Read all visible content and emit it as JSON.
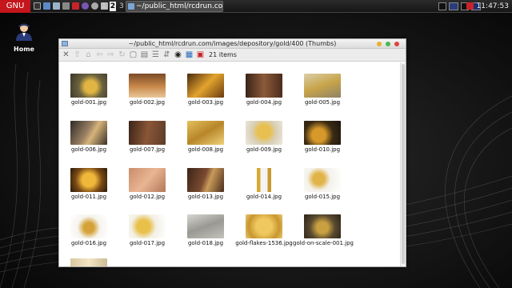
{
  "panel": {
    "menu_label": "GNU",
    "workspaces": [
      "1",
      "2",
      "3",
      "4"
    ],
    "active_workspace": "2",
    "task_title": "~/public_html/rcdrun.com/ima...",
    "clock": "11:47:53"
  },
  "desktop": {
    "home_label": "Home"
  },
  "window": {
    "title": "~/public_html/rcdrun.com/images/depository/gold/400 (Thumbs)",
    "items_count": "21 items",
    "files": [
      {
        "name": "gold-001.jpg"
      },
      {
        "name": "gold-002.jpg"
      },
      {
        "name": "gold-003.jpg"
      },
      {
        "name": "gold-004.jpg"
      },
      {
        "name": "gold-005.jpg"
      },
      {
        "name": "gold-006.jpg"
      },
      {
        "name": "gold-007.jpg"
      },
      {
        "name": "gold-008.jpg"
      },
      {
        "name": "gold-009.jpg"
      },
      {
        "name": "gold-010.jpg"
      },
      {
        "name": "gold-011.jpg"
      },
      {
        "name": "gold-012.jpg"
      },
      {
        "name": "gold-013.jpg"
      },
      {
        "name": "gold-014.jpg"
      },
      {
        "name": "gold-015.jpg"
      },
      {
        "name": "gold-016.jpg"
      },
      {
        "name": "gold-017.jpg"
      },
      {
        "name": "gold-018.jpg"
      },
      {
        "name": "gold-flakes-1536.jpg"
      },
      {
        "name": "gold-on-scale-001.jpg"
      },
      {
        "name": ""
      }
    ]
  },
  "colors": {
    "menu_red": "#c4161c",
    "close_button": "#e0443e",
    "minimize_button": "#e6b22c",
    "maximize_button": "#4cb84c"
  }
}
